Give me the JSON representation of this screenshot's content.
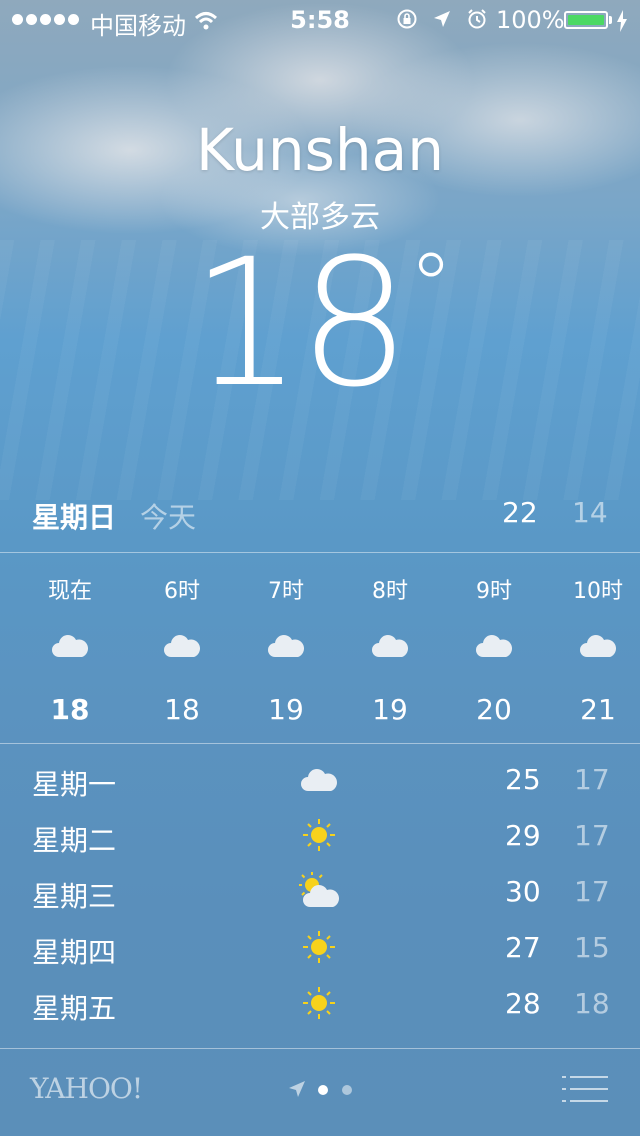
{
  "status_bar": {
    "carrier": "中国移动",
    "time": "5:58",
    "battery": "100%",
    "icons": [
      "signal-dots",
      "wifi-icon",
      "orientation-lock-icon",
      "location-icon",
      "alarm-icon",
      "battery-icon",
      "charging-bolt-icon"
    ],
    "battery_color": "#4cd964"
  },
  "header": {
    "city": "Kunshan",
    "condition": "大部多云",
    "temperature": "18",
    "degree": "°"
  },
  "today": {
    "day": "星期日",
    "tag": "今天",
    "high": "22",
    "low": "14"
  },
  "hourly": [
    {
      "time": "现在",
      "icon": "cloud-icon",
      "temp": "18"
    },
    {
      "time": "6时",
      "icon": "cloud-icon",
      "temp": "18"
    },
    {
      "time": "7时",
      "icon": "cloud-icon",
      "temp": "19"
    },
    {
      "time": "8时",
      "icon": "cloud-icon",
      "temp": "19"
    },
    {
      "time": "9时",
      "icon": "cloud-icon",
      "temp": "20"
    },
    {
      "time": "10时",
      "icon": "cloud-icon",
      "temp": "21"
    }
  ],
  "daily": [
    {
      "day": "星期一",
      "icon": "cloud-icon",
      "high": "25",
      "low": "17"
    },
    {
      "day": "星期二",
      "icon": "sun-icon",
      "high": "29",
      "low": "17"
    },
    {
      "day": "星期三",
      "icon": "partly-cloudy-icon",
      "high": "30",
      "low": "17"
    },
    {
      "day": "星期四",
      "icon": "sun-icon",
      "high": "27",
      "low": "15"
    },
    {
      "day": "星期五",
      "icon": "sun-icon",
      "high": "28",
      "low": "18"
    }
  ],
  "footer": {
    "brand": "YAHOO!",
    "page_count": "2",
    "active_page": "1"
  },
  "colors": {
    "sun": "#f7d21c",
    "cloud": "#e9eef3"
  }
}
